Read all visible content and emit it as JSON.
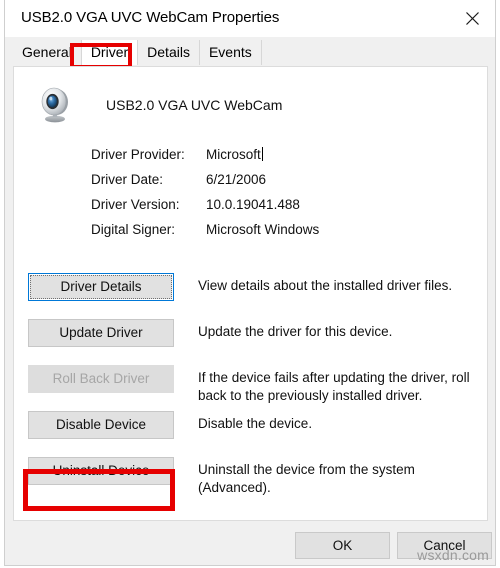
{
  "window": {
    "title": "USB2.0 VGA UVC WebCam Properties",
    "close_icon": "close-icon"
  },
  "tabs": [
    {
      "label": "General",
      "active": false
    },
    {
      "label": "Driver",
      "active": true
    },
    {
      "label": "Details",
      "active": false
    },
    {
      "label": "Events",
      "active": false
    }
  ],
  "device": {
    "icon": "webcam-icon",
    "name": "USB2.0 VGA UVC WebCam"
  },
  "properties": [
    {
      "label": "Driver Provider:",
      "value": "Microsoft"
    },
    {
      "label": "Driver Date:",
      "value": "6/21/2006"
    },
    {
      "label": "Driver Version:",
      "value": "10.0.19041.488"
    },
    {
      "label": "Digital Signer:",
      "value": "Microsoft Windows"
    }
  ],
  "actions": [
    {
      "button": "Driver Details",
      "description": "View details about the installed driver files.",
      "state": "focused"
    },
    {
      "button": "Update Driver",
      "description": "Update the driver for this device.",
      "state": "normal"
    },
    {
      "button": "Roll Back Driver",
      "description": "If the device fails after updating the driver, roll back to the previously installed driver.",
      "state": "disabled"
    },
    {
      "button": "Disable Device",
      "description": "Disable the device.",
      "state": "normal"
    },
    {
      "button": "Uninstall Device",
      "description": "Uninstall the device from the system (Advanced).",
      "state": "normal"
    }
  ],
  "footer": {
    "ok_label": "OK",
    "cancel_label": "Cancel"
  },
  "watermark": "wsxdn.com",
  "colors": {
    "annotation": "#e60000",
    "focus": "#0078d7",
    "dialog_bg": "#f0f0f0",
    "panel_bg": "#ffffff"
  }
}
